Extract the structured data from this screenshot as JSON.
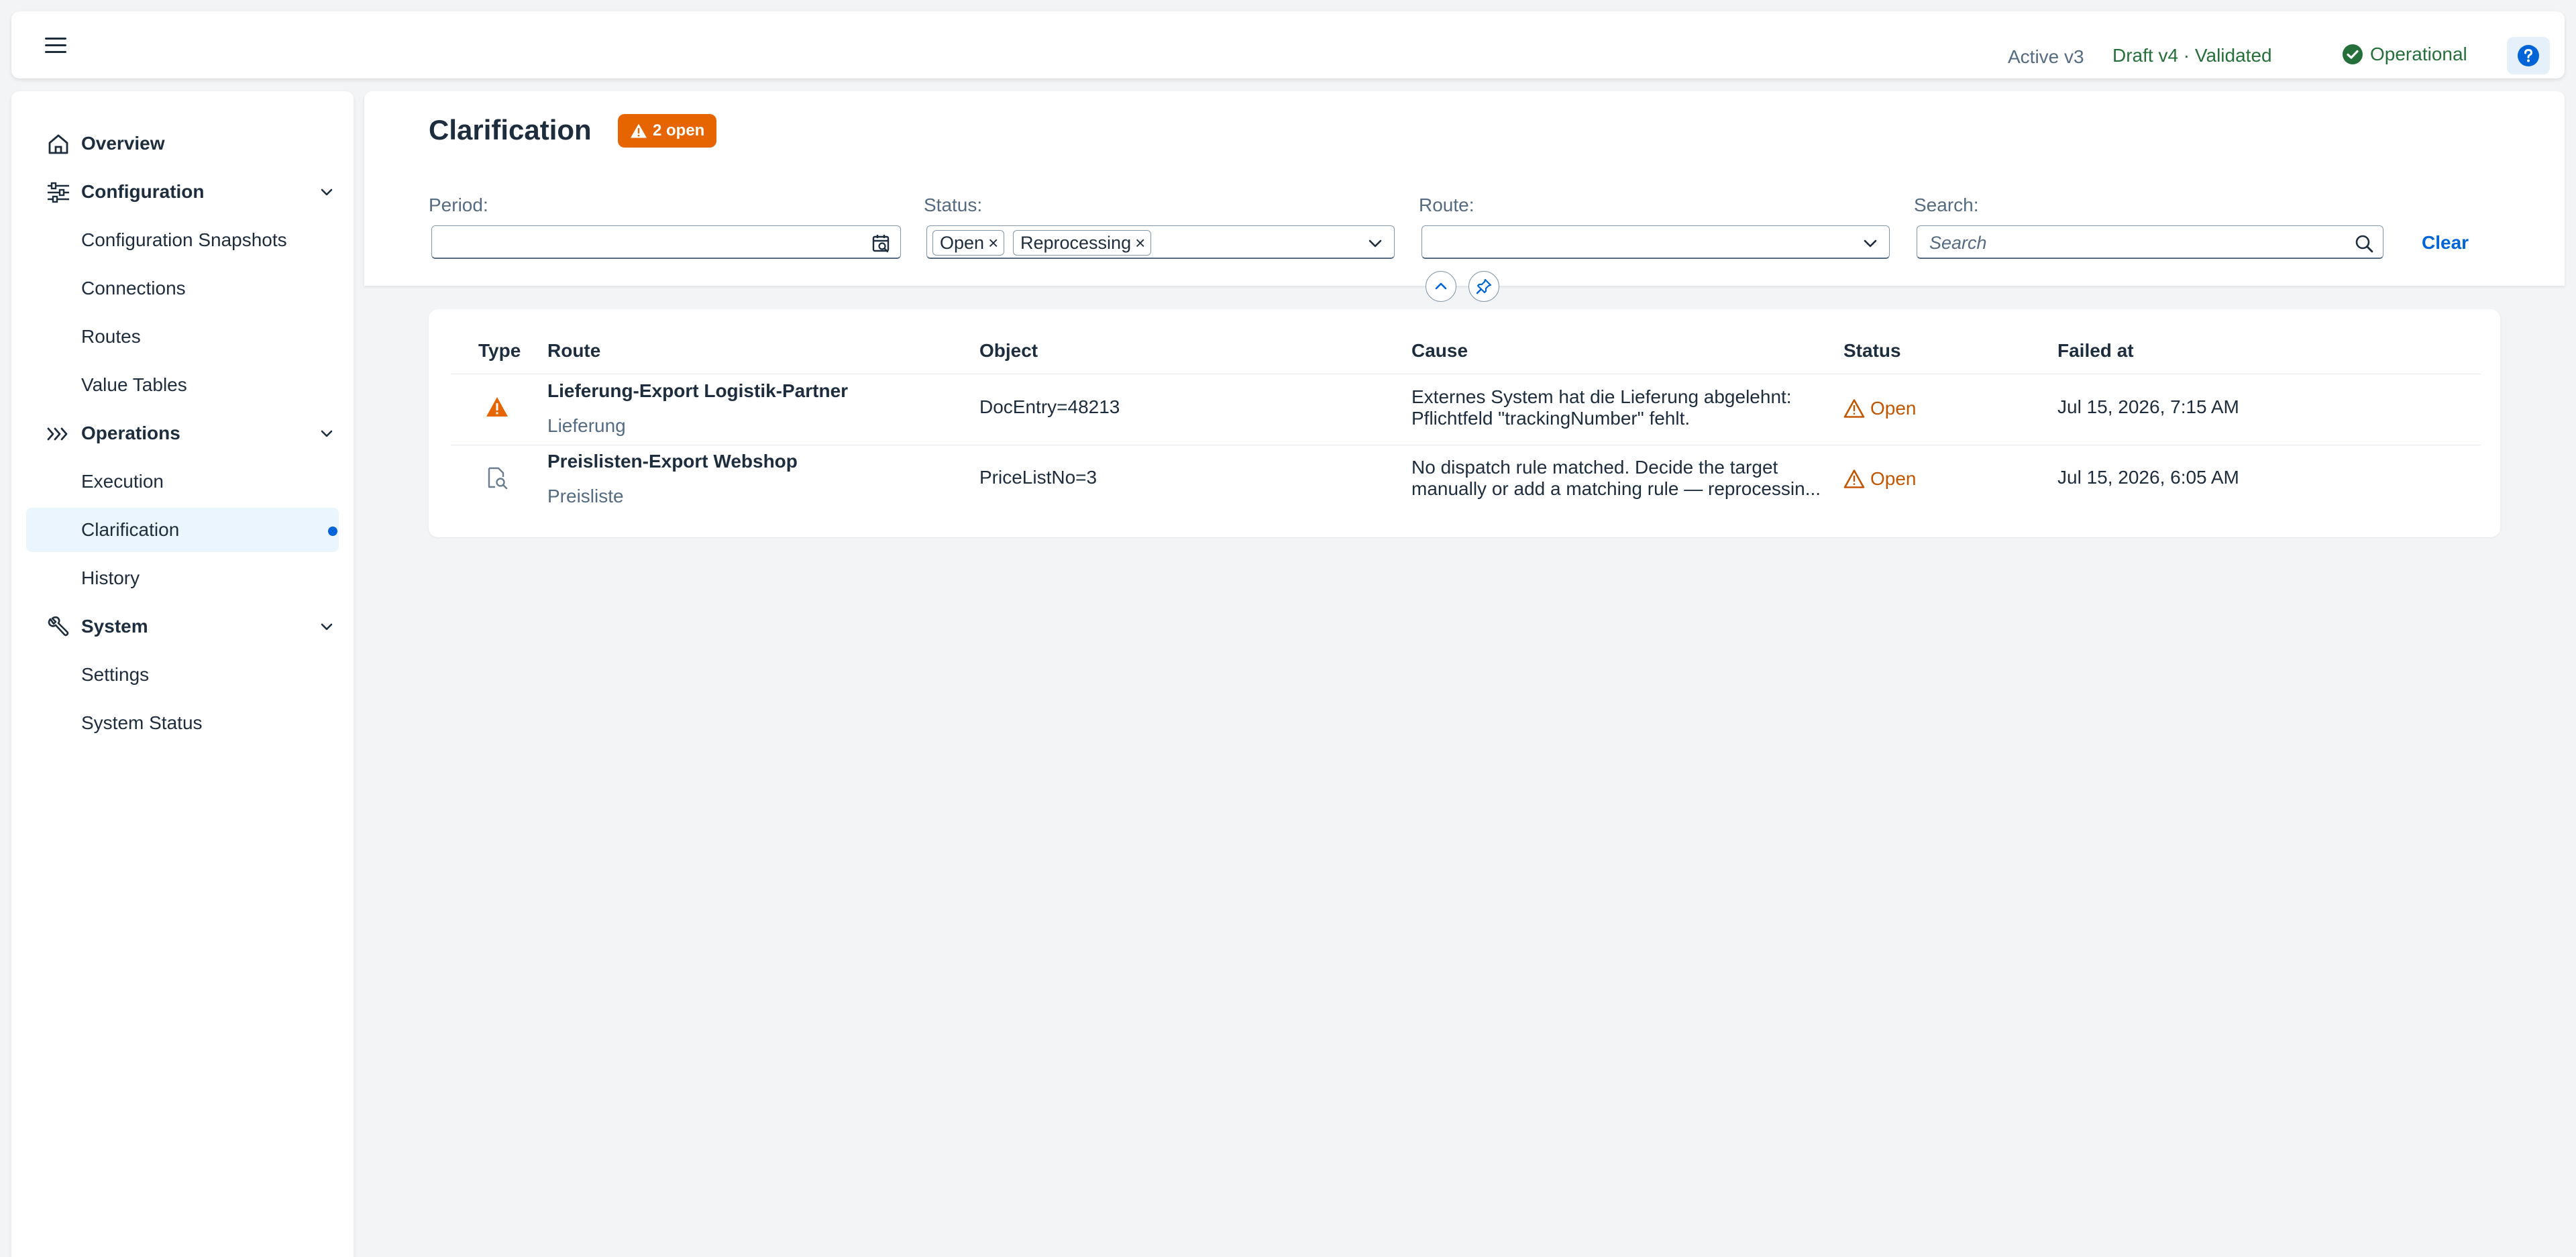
{
  "shellbar": {
    "active_version": "Active v3",
    "draft_version": "Draft v4 · Validated",
    "operational": "Operational",
    "colors": {
      "success": "#256f3a",
      "accent": "#0064d9"
    }
  },
  "sidebar": {
    "items": [
      {
        "label": "Overview",
        "icon": "home-icon"
      },
      {
        "label": "Configuration",
        "icon": "sliders-icon"
      },
      {
        "label": "Configuration Snapshots"
      },
      {
        "label": "Connections"
      },
      {
        "label": "Routes"
      },
      {
        "label": "Value Tables"
      },
      {
        "label": "Operations",
        "icon": "chevrons-right-icon"
      },
      {
        "label": "Execution"
      },
      {
        "label": "Clarification",
        "selected": true
      },
      {
        "label": "History"
      },
      {
        "label": "System",
        "icon": "wrench-icon"
      },
      {
        "label": "Settings"
      },
      {
        "label": "System Status"
      }
    ]
  },
  "page": {
    "title": "Clarification",
    "badge": "2 open",
    "badge_color": "#e76500"
  },
  "filters": {
    "period_label": "Period:",
    "period_value": "",
    "status_label": "Status:",
    "status_tokens": [
      "Open",
      "Reprocessing"
    ],
    "route_label": "Route:",
    "route_value": "",
    "search_label": "Search:",
    "search_placeholder": "Search",
    "clear": "Clear"
  },
  "table": {
    "columns": [
      "Type",
      "Route",
      "Object",
      "Cause",
      "Status",
      "Failed at"
    ],
    "rows": [
      {
        "type_icon": "warning-icon",
        "route": "Lieferung-Export Logistik-Partner",
        "route_sub": "Lieferung",
        "object": "DocEntry=48213",
        "cause_line1": "Externes System hat die Lieferung abgelehnt:",
        "cause_line2": "Pflichtfeld \"trackingNumber\" fehlt.",
        "status": "Open",
        "failed_at": "Jul 15, 2026, 7:15 AM"
      },
      {
        "type_icon": "document-search-icon",
        "route": "Preislisten-Export Webshop",
        "route_sub": "Preisliste",
        "object": "PriceListNo=3",
        "cause_line1": "No dispatch rule matched. Decide the target",
        "cause_line2": "manually or add a matching rule — reprocessin...",
        "status": "Open",
        "failed_at": "Jul 15, 2026, 6:05 AM"
      }
    ]
  }
}
